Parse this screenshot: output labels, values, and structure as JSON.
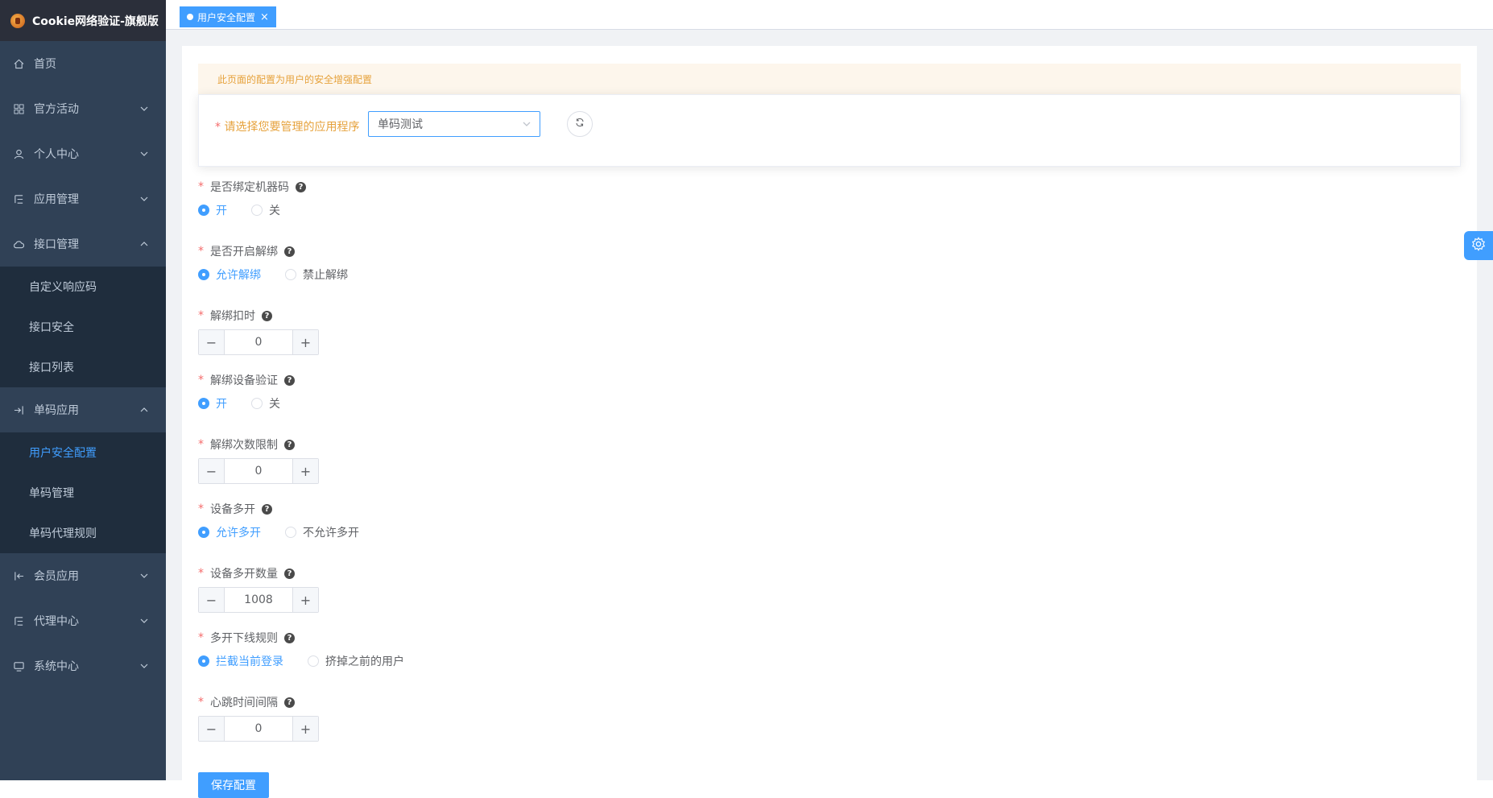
{
  "brand": {
    "title": "Cookie网络验证-旗舰版"
  },
  "sidebar": {
    "items": [
      {
        "label": "首页",
        "icon": "home-icon",
        "expanded": null
      },
      {
        "label": "官方活动",
        "icon": "grid-icon",
        "expanded": false
      },
      {
        "label": "个人中心",
        "icon": "user-icon",
        "expanded": false
      },
      {
        "label": "应用管理",
        "icon": "tree-icon",
        "expanded": false
      },
      {
        "label": "接口管理",
        "icon": "cloud-icon",
        "expanded": true,
        "children": [
          "自定义响应码",
          "接口安全",
          "接口列表"
        ]
      },
      {
        "label": "单码应用",
        "icon": "login-icon",
        "expanded": true,
        "children": [
          "用户安全配置",
          "单码管理",
          "单码代理规则"
        ]
      },
      {
        "label": "会员应用",
        "icon": "logout-icon",
        "expanded": false
      },
      {
        "label": "代理中心",
        "icon": "tree-icon",
        "expanded": false
      },
      {
        "label": "系统中心",
        "icon": "monitor-icon",
        "expanded": false
      }
    ],
    "active_child": "用户安全配置"
  },
  "tags": [
    {
      "label": "用户安全配置",
      "close": "×"
    }
  ],
  "notice": "此页面的配置为用户的安全增强配置",
  "app_select": {
    "label": "请选择您要管理的应用程序",
    "value": "单码测试"
  },
  "form": {
    "bind_machine": {
      "label": "是否绑定机器码",
      "options": [
        "开",
        "关"
      ],
      "selected": 0
    },
    "allow_unbind": {
      "label": "是否开启解绑",
      "options": [
        "允许解绑",
        "禁止解绑"
      ],
      "selected": 0
    },
    "unbind_deduct": {
      "label": "解绑扣时",
      "value": "0"
    },
    "unbind_device_verify": {
      "label": "解绑设备验证",
      "options": [
        "开",
        "关"
      ],
      "selected": 0
    },
    "unbind_limit": {
      "label": "解绑次数限制",
      "value": "0"
    },
    "multi_open": {
      "label": "设备多开",
      "options": [
        "允许多开",
        "不允许多开"
      ],
      "selected": 0
    },
    "multi_open_count": {
      "label": "设备多开数量",
      "value": "1008"
    },
    "multi_offline_rule": {
      "label": "多开下线规则",
      "options": [
        "拦截当前登录",
        "挤掉之前的用户"
      ],
      "selected": 0
    },
    "heartbeat_interval": {
      "label": "心跳时间间隔",
      "value": "0"
    }
  },
  "save_label": "保存配置",
  "colors": {
    "primary": "#409eff",
    "sidebar": "#304156",
    "warning": "#e6a23c",
    "danger": "#f56c6c"
  }
}
